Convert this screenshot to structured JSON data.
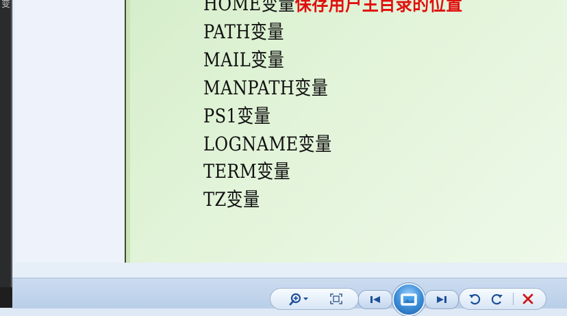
{
  "background_app": {
    "peek_text": "变"
  },
  "slide": {
    "top_line": {
      "prefix": "HOME变量",
      "highlight": "保存用户主目录的位置"
    },
    "lines": [
      "PATH变量",
      "MAIL变量",
      "MANPATH变量",
      "PS1变量",
      "LOGNAME变量",
      "TERM变量",
      "TZ变量"
    ]
  },
  "toolbar": {
    "buttons": [
      "zoom-icon",
      "actual-size-icon",
      "previous-icon",
      "slideshow-icon",
      "next-icon",
      "rotate-counterclockwise-icon",
      "rotate-clockwise-icon",
      "delete-icon"
    ]
  },
  "colors": {
    "slide_bg": "#e3f4da",
    "highlight_text": "#e0100e",
    "toolbar": "#c4d6ec"
  }
}
